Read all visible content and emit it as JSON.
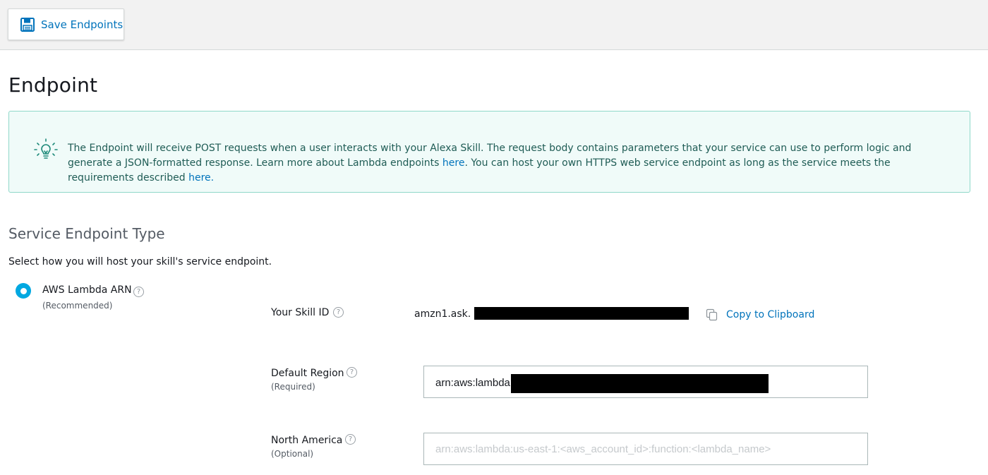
{
  "toolbar": {
    "save_label": "Save Endpoints",
    "save_icon": "floppy-disk-icon"
  },
  "page": {
    "title": "Endpoint"
  },
  "info": {
    "icon": "lightbulb-icon",
    "text_part1": "The Endpoint will receive POST requests when a user interacts with your Alexa Skill. The request body contains parameters that your service can use to perform logic and generate a JSON-formatted response. Learn more about Lambda endpoints ",
    "link1": "here",
    "text_part2": ". You can host your own HTTPS web service endpoint as long as the service meets the requirements described ",
    "link2": "here."
  },
  "service": {
    "title": "Service Endpoint Type",
    "description": "Select how you will host your skill's service endpoint.",
    "option": {
      "label": "AWS Lambda ARN",
      "sub": "(Recommended)",
      "selected": true
    }
  },
  "skill_id": {
    "label": "Your Skill ID",
    "value_prefix": "amzn1.ask.",
    "copy_label": "Copy to Clipboard",
    "copy_icon": "copy-icon"
  },
  "default_region": {
    "label": "Default Region",
    "sub": "(Required)",
    "value_prefix": "arn:aws:lambda:"
  },
  "north_america": {
    "label": "North America",
    "sub": "(Optional)",
    "placeholder": "arn:aws:lambda:us-east-1:<aws_account_id>:function:<lambda_name>"
  },
  "colors": {
    "accent": "#00a8e1",
    "link": "#0073bb",
    "info_bg": "#f0fbf9",
    "info_border": "#8fd8c9",
    "info_text": "#1f5c55"
  }
}
